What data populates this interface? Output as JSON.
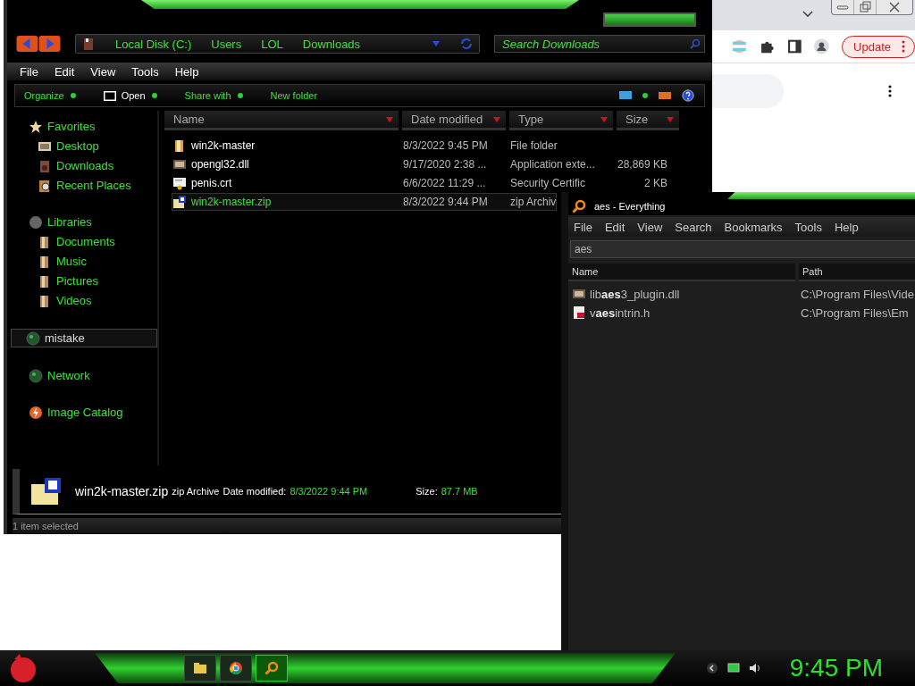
{
  "browser": {
    "update_button": "Update"
  },
  "explorer": {
    "breadcrumb": [
      "Local Disk (C:)",
      "Users",
      "LOL",
      "Downloads"
    ],
    "search": {
      "placeholder": "Search Downloads"
    },
    "menu": [
      "File",
      "Edit",
      "View",
      "Tools",
      "Help"
    ],
    "toolbar": [
      {
        "label": "Organize",
        "kind": "dropdown"
      },
      {
        "label": "Open",
        "kind": "open"
      },
      {
        "label": "Share with",
        "kind": "dropdown"
      },
      {
        "label": "New folder",
        "kind": "plain"
      }
    ],
    "sidebar": [
      {
        "label": "Favorites",
        "kind": "star",
        "selected": false,
        "children": [
          {
            "label": "Desktop",
            "kind": "desktop",
            "selected": false
          },
          {
            "label": "Downloads",
            "kind": "downloads",
            "selected": false
          },
          {
            "label": "Recent Places",
            "kind": "recent",
            "selected": false
          }
        ]
      },
      {
        "label": "Libraries",
        "kind": "libraries",
        "selected": false,
        "children": [
          {
            "label": "Documents",
            "kind": "library",
            "selected": false
          },
          {
            "label": "Music",
            "kind": "library",
            "selected": false
          },
          {
            "label": "Pictures",
            "kind": "library",
            "selected": false
          },
          {
            "label": "Videos",
            "kind": "library",
            "selected": false
          }
        ]
      },
      {
        "label": "mistake",
        "kind": "globe",
        "selected": true
      },
      {
        "label": "Network",
        "kind": "globe",
        "selected": false
      },
      {
        "label": "Image Catalog",
        "kind": "catalog",
        "selected": false
      }
    ],
    "columns": [
      "Name",
      "Date modified",
      "Type",
      "Size"
    ],
    "rows": [
      {
        "name": "win2k-master",
        "date": "8/3/2022 9:45 PM",
        "type": "File folder",
        "size": "",
        "kind": "folder",
        "selected": false
      },
      {
        "name": "opengl32.dll",
        "date": "9/17/2020 2:38 ...",
        "type": "Application exte...",
        "size": "28,869 KB",
        "kind": "dll",
        "selected": false
      },
      {
        "name": "penis.crt",
        "date": "6/6/2022 11:29 ...",
        "type": "Security Certific",
        "size": "2 KB",
        "kind": "cert",
        "selected": false
      },
      {
        "name": "win2k-master.zip",
        "date": "8/3/2022 9:44 PM",
        "type": "zip Archiv",
        "size": "",
        "kind": "zip",
        "selected": true
      }
    ],
    "details": {
      "name": "win2k-master.zip",
      "type": "zip Archive",
      "date_label": "Date modified:",
      "date": "8/3/2022 9:44 PM",
      "size_label": "Size:",
      "size": "87.7 MB"
    },
    "status": "1 item selected"
  },
  "everything": {
    "title": "aes - Everything",
    "menu": [
      "File",
      "Edit",
      "View",
      "Search",
      "Bookmarks",
      "Tools",
      "Help"
    ],
    "search": {
      "value": "aes"
    },
    "columns": [
      "Name",
      "Path"
    ],
    "rows": [
      {
        "name": "lib**aes**3_plugin.dll",
        "path": "C:\\Program Files\\Vide",
        "kind": "dll"
      },
      {
        "name": "v**aes**intrin.h",
        "path": "C:\\Program Files\\Em",
        "kind": "header"
      }
    ]
  },
  "taskbar": {
    "apps": [
      {
        "kind": "folder",
        "selected": false
      },
      {
        "kind": "browser",
        "selected": false
      },
      {
        "kind": "search",
        "selected": true
      }
    ],
    "clock": "9:45 PM"
  }
}
